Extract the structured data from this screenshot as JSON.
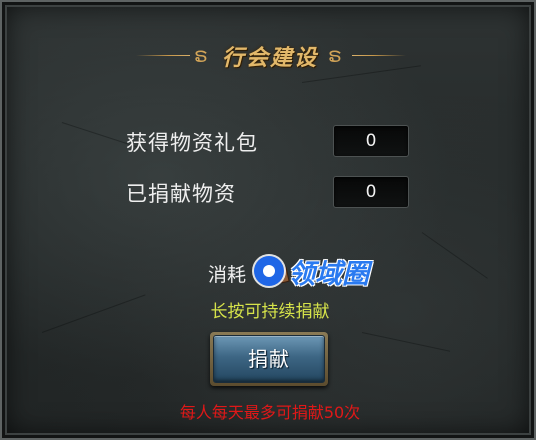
{
  "window": {
    "title": "行会建设"
  },
  "rows": [
    {
      "label": "获得物资礼包",
      "value": "0"
    },
    {
      "label": "已捐献物资",
      "value": "0"
    }
  ],
  "consume": {
    "label": "消耗",
    "icon": "material-pouch-icon"
  },
  "hint": "长按可持续捐献",
  "donate_button": {
    "label": "捐献"
  },
  "limit_text": "每人每天最多可捐献50次",
  "watermark": {
    "text": "领域圈"
  },
  "colors": {
    "title": "#e2b86a",
    "hint": "#d6e34a",
    "limit": "#e01818",
    "button": "#3d6684"
  }
}
